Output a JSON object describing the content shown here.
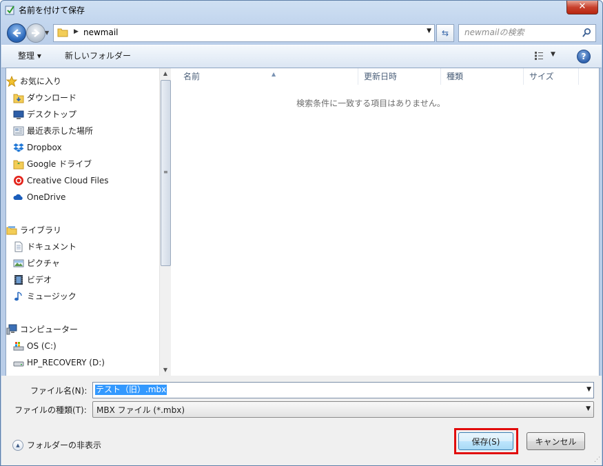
{
  "window": {
    "title": "名前を付けて保存",
    "close_label": "✕"
  },
  "address": {
    "path": "newmail"
  },
  "search": {
    "placeholder": "newmailの検索"
  },
  "toolbar": {
    "organize": "整理 ▾",
    "new_folder": "新しいフォルダー",
    "help": "?"
  },
  "nav": {
    "favorites": "お気に入り",
    "fav_items": [
      "ダウンロード",
      "デスクトップ",
      "最近表示した場所",
      "Dropbox",
      "Google ドライブ",
      "Creative Cloud Files",
      "OneDrive"
    ],
    "libraries": "ライブラリ",
    "lib_items": [
      "ドキュメント",
      "ピクチャ",
      "ビデオ",
      "ミュージック"
    ],
    "computer": "コンピューター",
    "comp_items": [
      "OS (C:)",
      "HP_RECOVERY (D:)"
    ]
  },
  "columns": {
    "name": "名前",
    "date": "更新日時",
    "type": "種類",
    "size": "サイズ"
  },
  "list": {
    "empty_message": "検索条件に一致する項目はありません。"
  },
  "form": {
    "filename_label": "ファイル名(N):",
    "filename_value": "テスト（旧）.mbx",
    "filetype_label": "ファイルの種類(T):",
    "filetype_value": "MBX ファイル (*.mbx)"
  },
  "footer": {
    "hide_folders": "フォルダーの非表示",
    "save": "保存(S)",
    "cancel": "キャンセル"
  },
  "colors": {
    "accent_highlight": "#e10b0b",
    "selection": "#3399ff"
  }
}
